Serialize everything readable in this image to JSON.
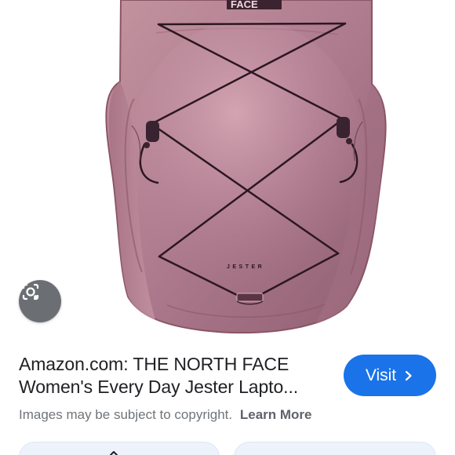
{
  "image": {
    "brand_mark": "FACE",
    "model_mark": "JESTER"
  },
  "result": {
    "title": "Amazon.com: THE NORTH FACE Women's Every Day Jester Lapto...",
    "visit_label": "Visit",
    "notice_text": "Images may be subject to copyright.",
    "learn_more_label": "Learn More"
  },
  "colors": {
    "accent": "#1a73e8",
    "backpack": "#b07d90"
  },
  "icons": {
    "lens": "lens-icon",
    "visit": "chevron-right-icon"
  }
}
